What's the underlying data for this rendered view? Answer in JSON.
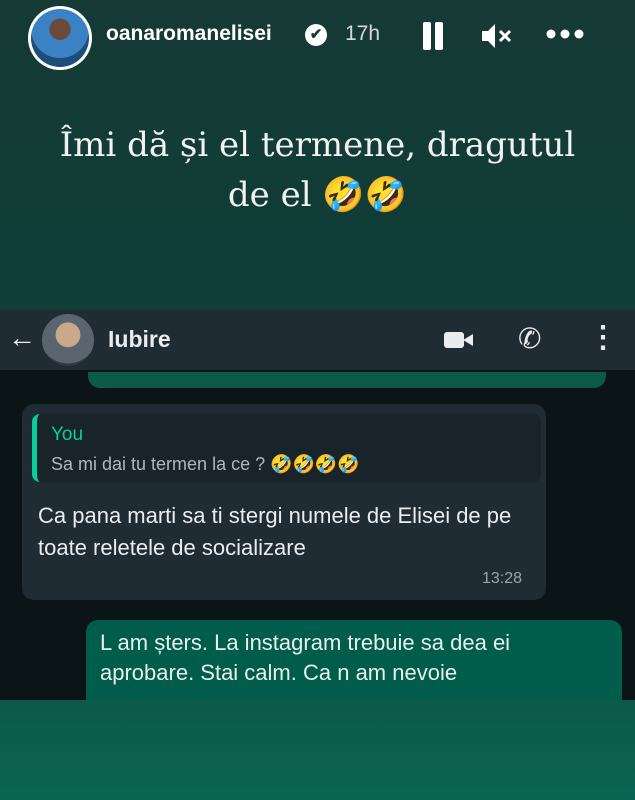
{
  "story": {
    "username": "oanaromanelisei",
    "verified_mark": "✔",
    "time_ago": "17h",
    "icons": {
      "pause": "pause-icon",
      "mute": "mute-icon",
      "more": "more-icon"
    },
    "caption_line1": "Îmi dă și el termene, dragutul",
    "caption_line2": "de el 🤣🤣"
  },
  "chat": {
    "back_glyph": "←",
    "contact_name": "Iubire",
    "call_glyph": "✆",
    "menu_glyph": "⋮",
    "incoming": {
      "quote_author": "You",
      "quote_text": "Sa mi dai tu termen la ce ? 🤣🤣🤣🤣",
      "text": "Ca pana marti sa ti stergi numele de Elisei de pe toate reletele de socializare",
      "time": "13:28"
    },
    "outgoing": {
      "text": "L am șters. La instagram trebuie sa dea ei aprobare. Stai calm. Ca n am nevoie"
    }
  },
  "colors": {
    "story_bg": "#0f3d37",
    "chat_bar": "#1f2c33",
    "incoming_bubble": "#1f2c33",
    "outgoing_bubble": "#005c4b",
    "quote_accent": "#06cf9c"
  }
}
